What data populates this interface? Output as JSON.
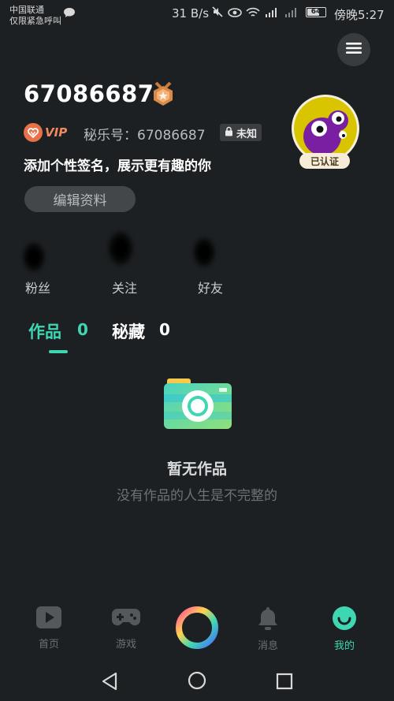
{
  "status_bar": {
    "carrier_line1": "中国联通",
    "carrier_line2": "仅限紧急呼叫",
    "speed": "31 B/s",
    "battery": "64",
    "time": "傍晚5:27"
  },
  "profile": {
    "username": "67086687",
    "vip_label": "VIP",
    "id_label": "秘乐号：67086687",
    "gender_label": "未知",
    "signature": "添加个性签名，展示更有趣的你",
    "edit_button": "编辑资料",
    "verified_label": "已认证"
  },
  "stats": [
    {
      "label": "粉丝"
    },
    {
      "label": "关注"
    },
    {
      "label": "好友"
    }
  ],
  "tabs": [
    {
      "label": "作品",
      "count": "0",
      "active": true
    },
    {
      "label": "秘藏",
      "count": "0",
      "active": false
    }
  ],
  "empty_state": {
    "title": "暂无作品",
    "subtitle": "没有作品的人生是不完整的"
  },
  "bottom_nav": [
    {
      "label": "首页",
      "icon": "play-icon"
    },
    {
      "label": "游戏",
      "icon": "gamepad-icon"
    },
    {
      "label": "",
      "icon": "create-ring-icon"
    },
    {
      "label": "消息",
      "icon": "bell-icon"
    },
    {
      "label": "我的",
      "icon": "smile-icon",
      "active": true
    }
  ],
  "colors": {
    "background": "#1d2022",
    "accent": "#3fd6b2",
    "vip": "#e8714a",
    "muted": "#6e7174"
  }
}
